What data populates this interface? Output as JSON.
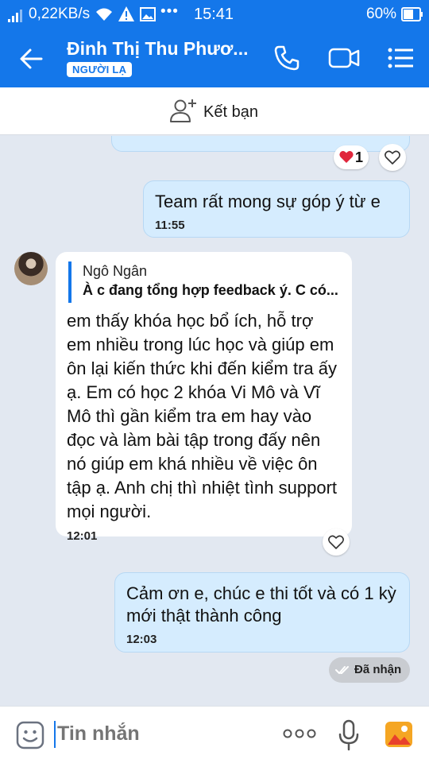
{
  "status_bar": {
    "network_speed": "0,22KB/s",
    "more_indicator": "•••",
    "time": "15:41",
    "battery_percent": "60%",
    "icons": [
      "signal-icon",
      "wifi-icon",
      "warning-icon",
      "image-icon",
      "battery-icon"
    ]
  },
  "header": {
    "contact_name": "Đinh Thị Thu Phươ...",
    "stranger_tag": "NGƯỜI LẠ",
    "icons": [
      "back-arrow-icon",
      "phone-icon",
      "video-camera-icon",
      "list-menu-icon"
    ]
  },
  "friend_bar": {
    "label": "Kết bạn"
  },
  "messages": [
    {
      "direction": "outgoing",
      "text": "Team rất mong sự góp ý từ e",
      "time": "11:55"
    },
    {
      "direction": "incoming",
      "quote": {
        "author": "Ngô Ngân",
        "text": "À c đang tổng hợp feedback ý. C có..."
      },
      "text": "em thấy khóa học bổ ích, hỗ trợ em nhiều trong lúc học và giúp em ôn lại kiến thức khi đến kiểm tra ấy ạ. Em có học 2 khóa Vi Mô và Vĩ Mô thì gần kiểm tra em hay vào đọc và làm bài tập trong đấy nên nó giúp em khá nhiều về việc ôn tập ạ. Anh chị thì nhiệt tình support mọi người.",
      "time": "12:01"
    },
    {
      "direction": "outgoing",
      "text": "Cảm ơn e, chúc e thi tốt và có 1 kỳ mới thật thành công",
      "time": "12:03"
    }
  ],
  "reaction": {
    "emoji": "heart",
    "count": "1"
  },
  "delivery_status": "Đã nhận",
  "composer": {
    "placeholder": "Tin nhắn"
  },
  "colors": {
    "brand_blue": "#1477ea",
    "outgoing_bubble": "#d5ecfe",
    "chat_background": "#e2e8f1",
    "heart_red": "#e0263c"
  }
}
